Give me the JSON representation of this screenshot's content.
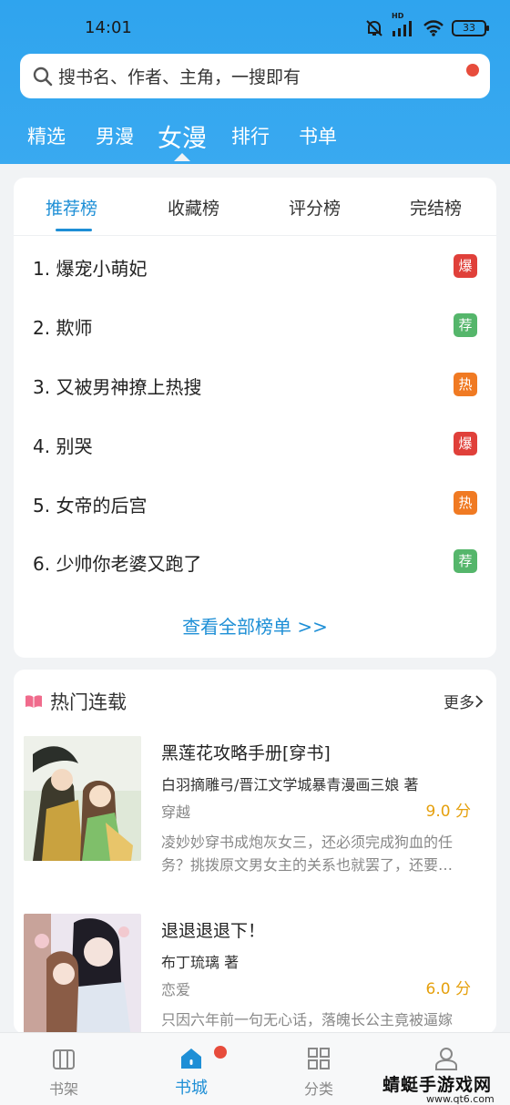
{
  "status_bar": {
    "time": "14:01",
    "battery": "33",
    "hd_label": "HD"
  },
  "search": {
    "placeholder": "搜书名、作者、主角，一搜即有"
  },
  "top_tabs": [
    "精选",
    "男漫",
    "女漫",
    "排行",
    "书单"
  ],
  "active_top_tab": "女漫",
  "rank_tabs": [
    "推荐榜",
    "收藏榜",
    "评分榜",
    "完结榜"
  ],
  "active_rank_tab": "推荐榜",
  "rank_list": [
    {
      "text": "1.  爆宠小萌妃",
      "badge": "爆",
      "badge_color": "#e0403a"
    },
    {
      "text": "2.  欺师",
      "badge": "荐",
      "badge_color": "#55b66b"
    },
    {
      "text": "3.  又被男神撩上热搜",
      "badge": "热",
      "badge_color": "#f07a23"
    },
    {
      "text": "4.  别哭",
      "badge": "爆",
      "badge_color": "#e0403a"
    },
    {
      "text": "5.  女帝的后宫",
      "badge": "热",
      "badge_color": "#f07a23"
    },
    {
      "text": "6.  少帅你老婆又跑了",
      "badge": "荐",
      "badge_color": "#55b66b"
    }
  ],
  "see_all": "查看全部榜单 >>",
  "hot_section": {
    "title": "热门连载",
    "more": "更多"
  },
  "books": [
    {
      "title": "黑莲花攻略手册[穿书]",
      "author": "白羽摘雕弓/晋江文学城暴青漫画三娘 著",
      "genre": "穿越",
      "score": "9.0 分",
      "desc": "凌妙妙穿书成炮灰女三，还必须完成狗血的任务？挑拨原文男女主的关系也就罢了，还要…"
    },
    {
      "title": "退退退退下！",
      "author": "布丁琉璃 著",
      "genre": "恋爱",
      "score": "6.0 分",
      "desc": "只因六年前一句无心话，落魄长公主竟被逼嫁"
    }
  ],
  "bottom_nav": [
    {
      "label": "书架",
      "icon": "bookshelf-icon"
    },
    {
      "label": "书城",
      "icon": "home-icon"
    },
    {
      "label": "分类",
      "icon": "category-icon"
    },
    {
      "label": "",
      "icon": "user-icon"
    }
  ],
  "watermark": {
    "text": "蜻蜓手游戏网",
    "url": "www.qt6.com"
  },
  "colors": {
    "header_blue": "#2fa4ee",
    "accent_blue": "#1e8fd6",
    "score_gold": "#e5a00d"
  }
}
